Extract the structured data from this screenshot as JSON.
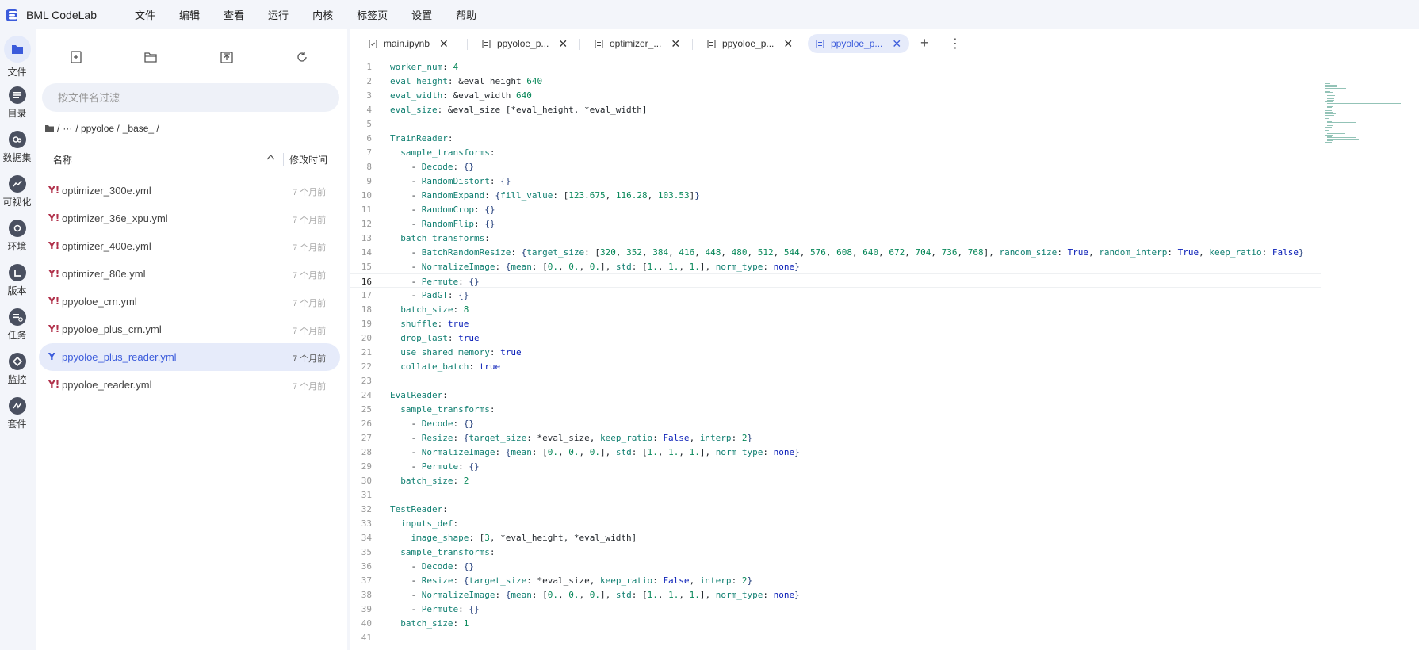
{
  "app": {
    "name": "BML CodeLab"
  },
  "menu": [
    "文件",
    "编辑",
    "查看",
    "运行",
    "内核",
    "标签页",
    "设置",
    "帮助"
  ],
  "activity": [
    {
      "label": "文件",
      "icon": "folder-icon",
      "active": true
    },
    {
      "label": "目录",
      "icon": "list-icon"
    },
    {
      "label": "数据集",
      "icon": "dataset-icon"
    },
    {
      "label": "可视化",
      "icon": "chart-icon"
    },
    {
      "label": "环境",
      "icon": "environment-icon"
    },
    {
      "label": "版本",
      "icon": "version-icon"
    },
    {
      "label": "任务",
      "icon": "task-icon"
    },
    {
      "label": "监控",
      "icon": "monitor-icon"
    },
    {
      "label": "套件",
      "icon": "suite-icon"
    }
  ],
  "filepanel": {
    "toolbar": [
      "new-file-icon",
      "new-folder-icon",
      "upload-icon",
      "refresh-icon"
    ],
    "filter_placeholder": "按文件名过滤",
    "breadcrumb": [
      "/",
      "···",
      "/ ppyoloe /",
      "_base_ /"
    ],
    "header": {
      "name": "名称",
      "modified": "修改时间"
    },
    "files": [
      {
        "name": "optimizer_300e.yml",
        "date": "7 个月前"
      },
      {
        "name": "optimizer_36e_xpu.yml",
        "date": "7 个月前"
      },
      {
        "name": "optimizer_400e.yml",
        "date": "7 个月前"
      },
      {
        "name": "optimizer_80e.yml",
        "date": "7 个月前"
      },
      {
        "name": "ppyoloe_crn.yml",
        "date": "7 个月前"
      },
      {
        "name": "ppyoloe_plus_crn.yml",
        "date": "7 个月前"
      },
      {
        "name": "ppyoloe_plus_reader.yml",
        "date": "7 个月前",
        "selected": true
      },
      {
        "name": "ppyoloe_reader.yml",
        "date": "7 个月前"
      }
    ]
  },
  "tabs": [
    {
      "label": "main.ipynb",
      "icon": "notebook-icon"
    },
    {
      "label": "ppyoloe_p...",
      "icon": "file-icon"
    },
    {
      "label": "optimizer_...",
      "icon": "file-icon"
    },
    {
      "label": "ppyoloe_p...",
      "icon": "file-icon"
    },
    {
      "label": "ppyoloe_p...",
      "icon": "file-icon",
      "active": true
    }
  ],
  "editor": {
    "current_line": 16,
    "lines": [
      "worker_num: 4",
      "eval_height: &eval_height 640",
      "eval_width: &eval_width 640",
      "eval_size: &eval_size [*eval_height, *eval_width]",
      "",
      "TrainReader:",
      "  sample_transforms:",
      "    - Decode: {}",
      "    - RandomDistort: {}",
      "    - RandomExpand: {fill_value: [123.675, 116.28, 103.53]}",
      "    - RandomCrop: {}",
      "    - RandomFlip: {}",
      "  batch_transforms:",
      "    - BatchRandomResize: {target_size: [320, 352, 384, 416, 448, 480, 512, 544, 576, 608, 640, 672, 704, 736, 768], random_size: True, random_interp: True, keep_ratio: False}",
      "    - NormalizeImage: {mean: [0., 0., 0.], std: [1., 1., 1.], norm_type: none}",
      "    - Permute: {}",
      "    - PadGT: {}",
      "  batch_size: 8",
      "  shuffle: true",
      "  drop_last: true",
      "  use_shared_memory: true",
      "  collate_batch: true",
      "",
      "EvalReader:",
      "  sample_transforms:",
      "    - Decode: {}",
      "    - Resize: {target_size: *eval_size, keep_ratio: False, interp: 2}",
      "    - NormalizeImage: {mean: [0., 0., 0.], std: [1., 1., 1.], norm_type: none}",
      "    - Permute: {}",
      "  batch_size: 2",
      "",
      "TestReader:",
      "  inputs_def:",
      "    image_shape: [3, *eval_height, *eval_width]",
      "  sample_transforms:",
      "    - Decode: {}",
      "    - Resize: {target_size: *eval_size, keep_ratio: False, interp: 2}",
      "    - NormalizeImage: {mean: [0., 0., 0.], std: [1., 1., 1.], norm_type: none}",
      "    - Permute: {}",
      "  batch_size: 1",
      ""
    ]
  },
  "colors": {
    "accent": "#3b5bdb",
    "selected_bg": "#e6ebfa",
    "panel_bg": "#f3f5fa"
  }
}
